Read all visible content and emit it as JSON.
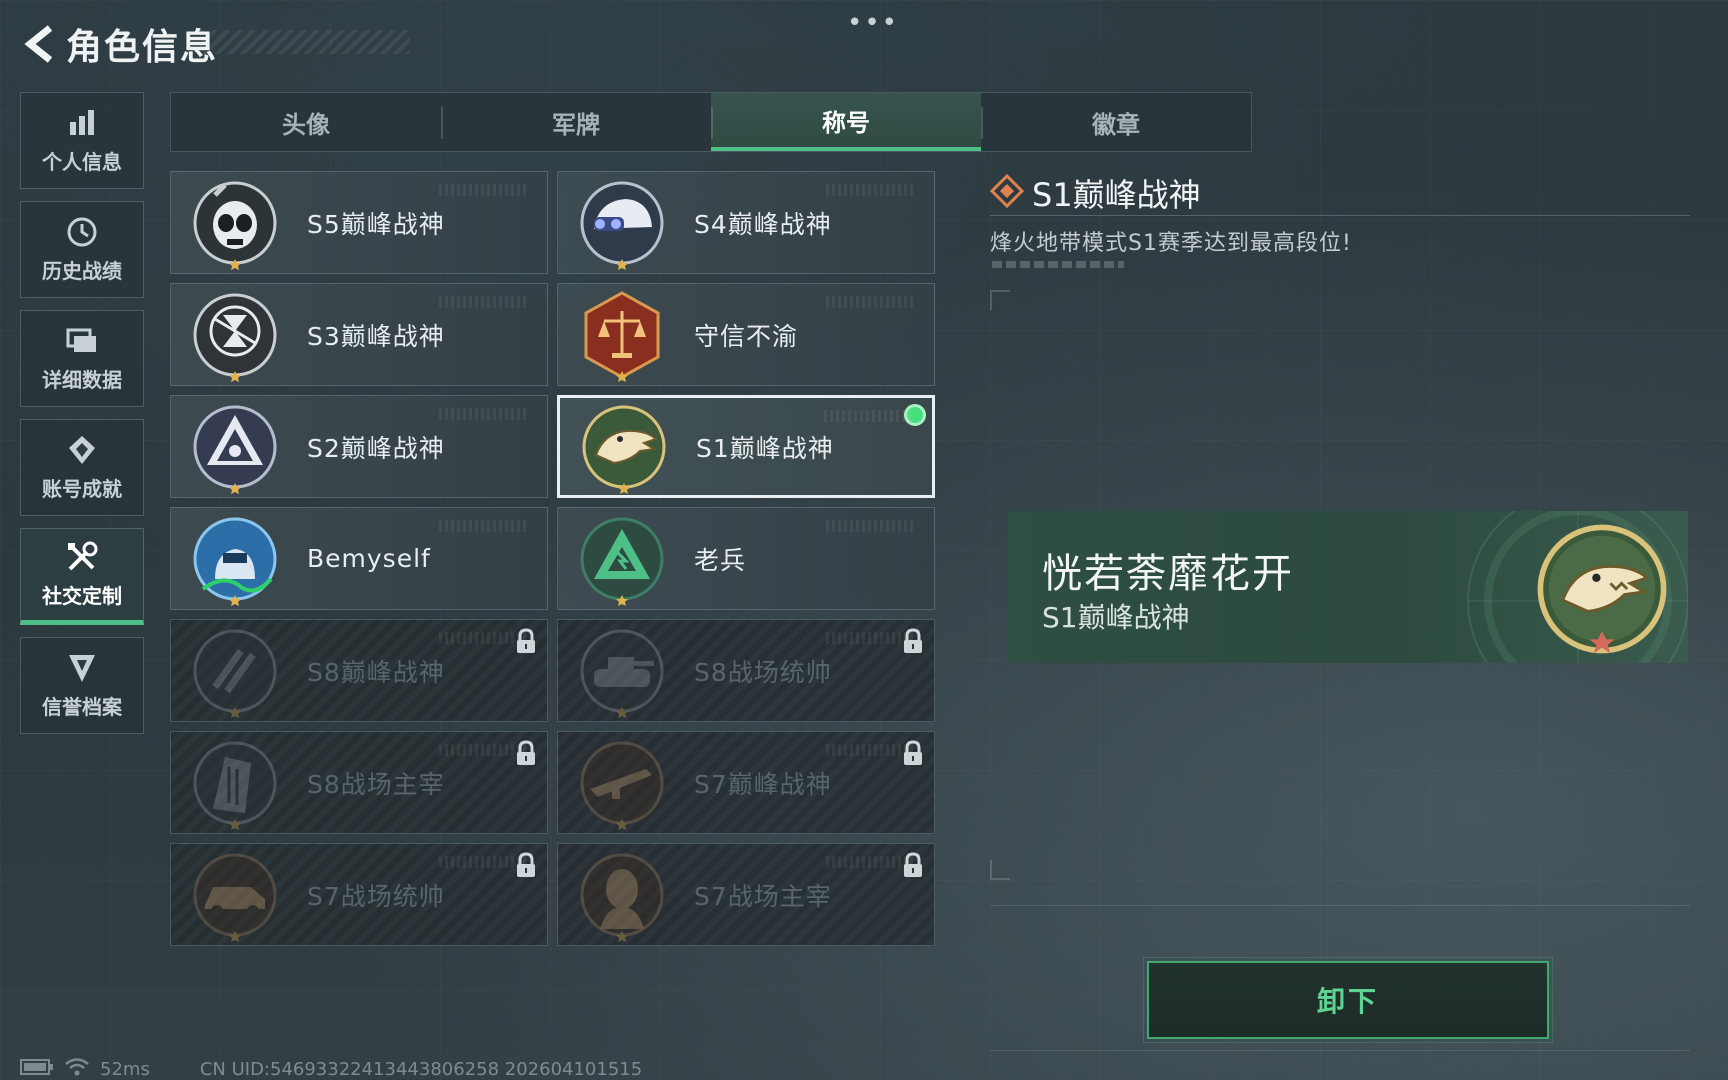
{
  "header": {
    "title": "角色信息",
    "more": "•••"
  },
  "sidenav": [
    {
      "label": "个人信息",
      "icon": "bar-chart-icon",
      "active": false
    },
    {
      "label": "历史战绩",
      "icon": "history-icon",
      "active": false
    },
    {
      "label": "详细数据",
      "icon": "folder-icon",
      "active": false
    },
    {
      "label": "账号成就",
      "icon": "achievement-icon",
      "active": false
    },
    {
      "label": "社交定制",
      "icon": "tools-icon",
      "active": true
    },
    {
      "label": "信誉档案",
      "icon": "shield-icon",
      "active": false
    }
  ],
  "tabs": [
    {
      "label": "头像",
      "active": false
    },
    {
      "label": "军牌",
      "active": false
    },
    {
      "label": "称号",
      "active": true
    },
    {
      "label": "徽章",
      "active": false
    }
  ],
  "titles": [
    {
      "name": "S5巅峰战神",
      "emblem": "skull-mask-emblem",
      "locked": false
    },
    {
      "name": "S4巅峰战神",
      "emblem": "night-vision-helmet-emblem",
      "locked": false
    },
    {
      "name": "S3巅峰战神",
      "emblem": "hourglass-globe-emblem",
      "locked": false
    },
    {
      "name": "守信不渝",
      "emblem": "scales-emblem",
      "locked": false
    },
    {
      "name": "S2巅峰战神",
      "emblem": "triangle-eye-emblem",
      "locked": false
    },
    {
      "name": "S1巅峰战神",
      "emblem": "crocodile-emblem",
      "locked": false,
      "selected": true,
      "equipped": true
    },
    {
      "name": "Bemyself",
      "emblem": "signature-soldier-emblem",
      "locked": false
    },
    {
      "name": "老兵",
      "emblem": "veteran-triangle-emblem",
      "locked": false
    },
    {
      "name": "S8巅峰战神",
      "emblem": "slash-emblem",
      "locked": true
    },
    {
      "name": "S8战场统帅",
      "emblem": "tank-emblem",
      "locked": true
    },
    {
      "name": "S8战场主宰",
      "emblem": "building-emblem",
      "locked": true
    },
    {
      "name": "S7巅峰战神",
      "emblem": "rifle-emblem",
      "locked": true
    },
    {
      "name": "S7战场统帅",
      "emblem": "vehicle-emblem",
      "locked": true
    },
    {
      "name": "S7战场主宰",
      "emblem": "soldier-portrait-emblem",
      "locked": true
    }
  ],
  "detail": {
    "title": "S1巅峰战神",
    "description": "烽火地带模式S1赛季达到最高段位!",
    "preview_nickname": "恍若荼靡花开",
    "preview_title": "S1巅峰战神",
    "action_label": "卸下"
  },
  "status": {
    "ping": "52ms",
    "uid": "CN UID:54693322413443806258 202604101515"
  },
  "colors": {
    "accent_green": "#4fbf88",
    "equipped_dot": "#45e07e",
    "title_icon": "#e0824a"
  }
}
